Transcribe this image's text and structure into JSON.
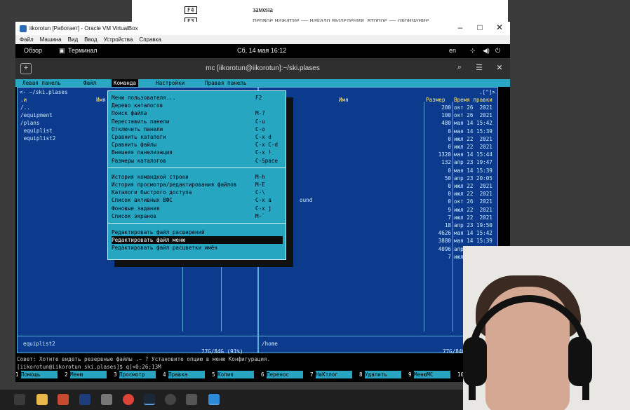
{
  "bg_doc": {
    "key1": "F4",
    "key2": "F3",
    "line1": "замена",
    "line2": "первое нажатие — начало выделения, второе — окончание"
  },
  "vbox": {
    "title": "iikorotun [Работает] - Oracle VM VirtualBox",
    "menu": [
      "Файл",
      "Машина",
      "Вид",
      "Ввод",
      "Устройства",
      "Справка"
    ]
  },
  "gnome": {
    "overview": "Обзор",
    "app": "Терминал",
    "clock": "Сб, 14 мая 16:12",
    "lang": "en"
  },
  "terminal": {
    "title": "mc [iikorotun@iikorotun]:~/ski.plases"
  },
  "mc_menu": [
    "Левая панель",
    "Файл",
    "Команда",
    "Настройки",
    "Правая панель"
  ],
  "left_panel": {
    "path": "<- ~/ski.plases",
    "col_n": ".и",
    "col_name": "Имя",
    "files": [
      "/..",
      "/equipment",
      "/plans",
      " equiplist",
      " equiplist2"
    ],
    "status": "equiplist2",
    "free": "77G/84G (91%)"
  },
  "right_panel": {
    "marker": ".[^]>",
    "col_name": "Имя",
    "col_size": "Размер",
    "col_time": "Время правки",
    "sizes": [
      "200",
      "100",
      "480",
      "0",
      "0",
      "0",
      "1320",
      "132",
      "0",
      "50",
      "0",
      "0",
      "0",
      "9",
      "7",
      "18",
      "4626",
      "3880",
      "4096",
      "7"
    ],
    "times": [
      "окт 26  2021",
      "окт 26  2021",
      "мая 14 15:42",
      "мая 14 15:39",
      "июл 22  2021",
      "июл 22  2021",
      "мая 14 15:44",
      "апр 23 19:47",
      "мая 14 15:39",
      "апр 23 20:05",
      "июл 22  2021",
      "июл 22  2021",
      "окт 26  2021",
      "июл 22  2021",
      "июл 22  2021",
      "апр 23 19:50",
      "мая 14 15:42",
      "мая 14 15:39",
      "апр",
      "июл"
    ],
    "extra_name": "ound",
    "status": "/home",
    "free": "77G/84G (91%)"
  },
  "command_menu": {
    "group1": [
      {
        "label": "Меню пользователя...",
        "key": "F2"
      },
      {
        "label": "Дерево каталогов",
        "key": ""
      },
      {
        "label": "Поиск файла",
        "key": "M-?"
      },
      {
        "label": "Переставить панели",
        "key": "C-u"
      },
      {
        "label": "Отключить панели",
        "key": "C-o"
      },
      {
        "label": "Сравнить каталоги",
        "key": "C-x d"
      },
      {
        "label": "Сравнить файлы",
        "key": "C-x C-d"
      },
      {
        "label": "Внешняя панелизация",
        "key": "C-x !"
      },
      {
        "label": "Размеры каталогов",
        "key": "C-Space"
      }
    ],
    "group2": [
      {
        "label": "История командной строки",
        "key": "M-h"
      },
      {
        "label": "История просмотра/редактирования файлов",
        "key": "M-E"
      },
      {
        "label": "Каталоги быстрого доступа",
        "key": "C-\\"
      },
      {
        "label": "Список активных ВФС",
        "key": "C-x a"
      },
      {
        "label": "Фоновые задания",
        "key": "C-x j"
      },
      {
        "label": "Список экранов",
        "key": "M-`"
      }
    ],
    "group3": [
      {
        "label": "Редактировать файл расширений",
        "key": ""
      },
      {
        "label": "Редактировать файл меню",
        "key": ""
      },
      {
        "label": "Редактировать файл расцветки имён",
        "key": ""
      }
    ]
  },
  "hint": "Совет: Хотите видеть резервные файлы .~ ? Установите опцию в меню Конфигурация.",
  "prompt": "[iikorotun@iikorotun ski.plases]$ q[<0;26;13M",
  "fkeys": [
    {
      "n": "1",
      "l": "Помощь"
    },
    {
      "n": "2",
      "l": "Меню"
    },
    {
      "n": "3",
      "l": "Просмотр"
    },
    {
      "n": "4",
      "l": "Правка"
    },
    {
      "n": "5",
      "l": "Копия"
    },
    {
      "n": "6",
      "l": "Перенос"
    },
    {
      "n": "7",
      "l": "НвКтлог"
    },
    {
      "n": "8",
      "l": "Удалить"
    },
    {
      "n": "9",
      "l": "МенюMC"
    },
    {
      "n": "10",
      "l": ""
    }
  ]
}
